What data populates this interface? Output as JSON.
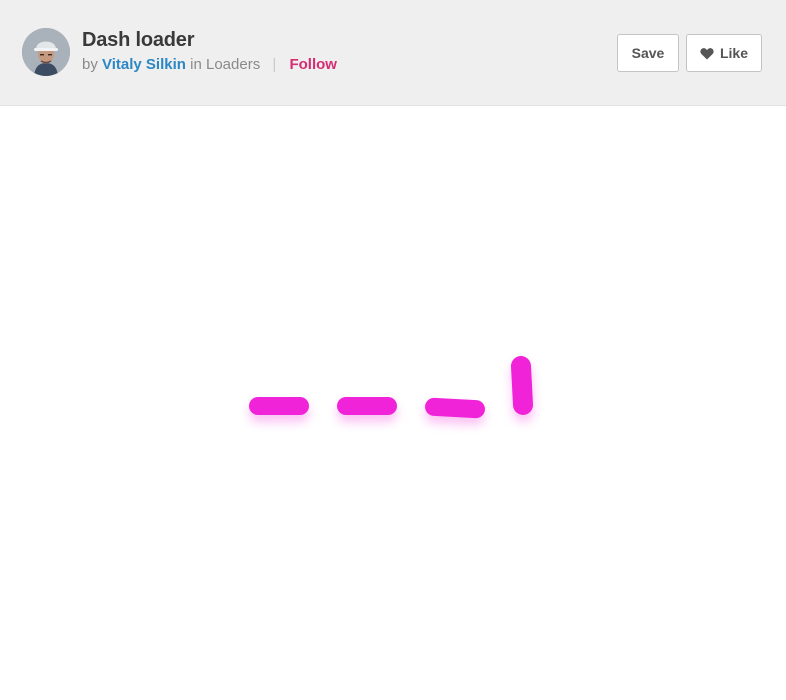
{
  "header": {
    "title": "Dash loader",
    "by_label": "by",
    "author": "Vitaly Silkin",
    "in_label": "in",
    "collection": "Loaders",
    "separator": "|",
    "follow_label": "Follow"
  },
  "actions": {
    "save_label": "Save",
    "like_label": "Like"
  },
  "colors": {
    "dash": "#f023d8",
    "author_link": "#2c87c4",
    "follow": "#d42d74"
  },
  "loader": {
    "dash_count": 4
  }
}
